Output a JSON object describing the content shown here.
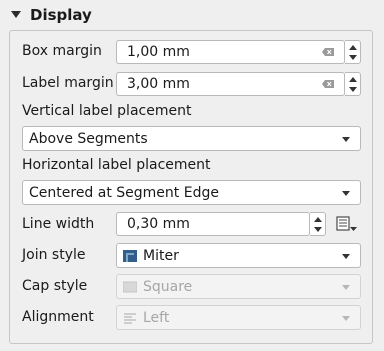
{
  "header": {
    "title": "Display"
  },
  "box_margin": {
    "label": "Box margin",
    "value": "1,00 mm"
  },
  "label_margin": {
    "label": "Label margin",
    "value": "3,00 mm"
  },
  "vertical_placement": {
    "label": "Vertical label placement",
    "value": "Above Segments"
  },
  "horizontal_placement": {
    "label": "Horizontal label placement",
    "value": "Centered at Segment Edge"
  },
  "line_width": {
    "label": "Line width",
    "value": "0,30 mm"
  },
  "join_style": {
    "label": "Join style",
    "value": "Miter",
    "icon": "miter-join-icon"
  },
  "cap_style": {
    "label": "Cap style",
    "value": "Square",
    "icon": "square-cap-icon"
  },
  "alignment": {
    "label": "Alignment",
    "value": "Left",
    "icon": "align-left-icon"
  }
}
